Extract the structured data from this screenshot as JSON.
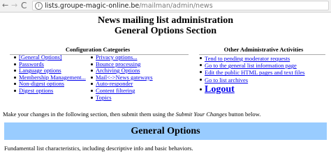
{
  "browser": {
    "back": "←",
    "forward": "→",
    "reload": "C",
    "info": "i",
    "url_host": "lists.groupe-magic-online.be",
    "url_path": "/mailman/admin/news"
  },
  "page": {
    "title_line1": "News mailing list administration",
    "title_line2": "General Options Section"
  },
  "config": {
    "header": "Configuration Categories",
    "col1": [
      "[General Options]",
      "Passwords",
      "Language options",
      "Membership Management...",
      "Non-digest options",
      "Digest options"
    ],
    "col2": [
      "Privacy options...",
      "Bounce processing",
      "Archiving Options",
      "Mail<->News gateways",
      "Auto-responder",
      "Content filtering",
      "Topics"
    ]
  },
  "admin": {
    "header": "Other Administrative Activities",
    "links": [
      "Tend to pending moderator requests",
      "Go to the general list information page",
      "Edit the public HTML pages and text files",
      "Go to list archives"
    ],
    "logout": "Logout"
  },
  "instructions": {
    "before": "Make your changes in the following section, then submit them using the ",
    "emphasis": "Submit Your Changes",
    "after": " button below."
  },
  "section": {
    "banner": "General Options",
    "description": "Fundamental list characteristics, including descriptive info and basic behaviors."
  }
}
